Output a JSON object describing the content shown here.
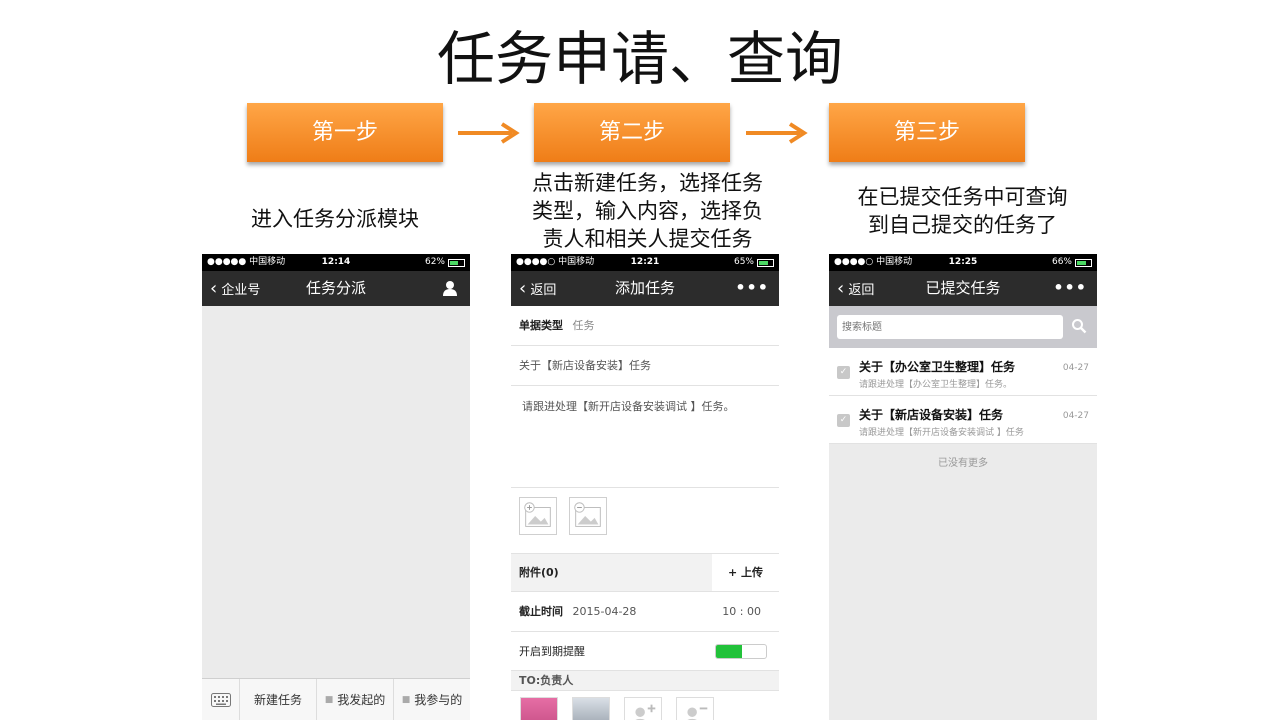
{
  "slide": {
    "title": "任务申请、查询"
  },
  "steps": [
    {
      "label": "第一步",
      "desc": [
        "进入任务分派模块"
      ]
    },
    {
      "label": "第二步",
      "desc": [
        "点击新建任务，选择任务",
        "类型，输入内容，选择负",
        "责人和相关人提交任务"
      ]
    },
    {
      "label": "第三步",
      "desc": [
        "在已提交任务中可查询",
        "到自己提交的任务了"
      ]
    }
  ],
  "phone1": {
    "status": {
      "carrier": "●●●●● 中国移动",
      "time": "12:14",
      "battery": "62%"
    },
    "nav": {
      "back": "企业号",
      "title": "任务分派"
    },
    "tabs": [
      "新建任务",
      "我发起的",
      "我参与的"
    ],
    "icons": {
      "keyboard": "keyboard-icon",
      "profile": "person-icon"
    }
  },
  "phone2": {
    "status": {
      "carrier": "●●●●○ 中国移动",
      "time": "12:21",
      "battery": "65%"
    },
    "nav": {
      "back": "返回",
      "title": "添加任务",
      "more": "•••"
    },
    "doc_type_label": "单据类型",
    "doc_type_value": "任务",
    "subject": "关于【新店设备安装】任务",
    "content": "请跟进处理【新开店设备安装调试 】任务。",
    "attachment_label": "附件(0)",
    "upload_label": "上传",
    "deadline_label": "截止时间",
    "deadline_date": "2015-04-28",
    "deadline_time": "10 : 00",
    "reminder_label": "开启到期提醒",
    "reminder_on": true,
    "to_label": "TO:负责人",
    "accent": "#22c23a"
  },
  "phone3": {
    "status": {
      "carrier": "●●●●○ 中国移动",
      "time": "12:25",
      "battery": "66%"
    },
    "nav": {
      "back": "返回",
      "title": "已提交任务",
      "more": "•••"
    },
    "search_placeholder": "搜索标题",
    "items": [
      {
        "title": "关于【办公室卫生整理】任务",
        "subtitle": "请跟进处理【办公室卫生整理】任务。",
        "date": "04-27"
      },
      {
        "title": "关于【新店设备安装】任务",
        "subtitle": "请跟进处理【新开店设备安装调试 】任务",
        "date": "04-27"
      }
    ],
    "no_more": "已没有更多"
  },
  "colors": {
    "step_orange": "#f08a24",
    "nav_dark": "#2c2c2c"
  }
}
